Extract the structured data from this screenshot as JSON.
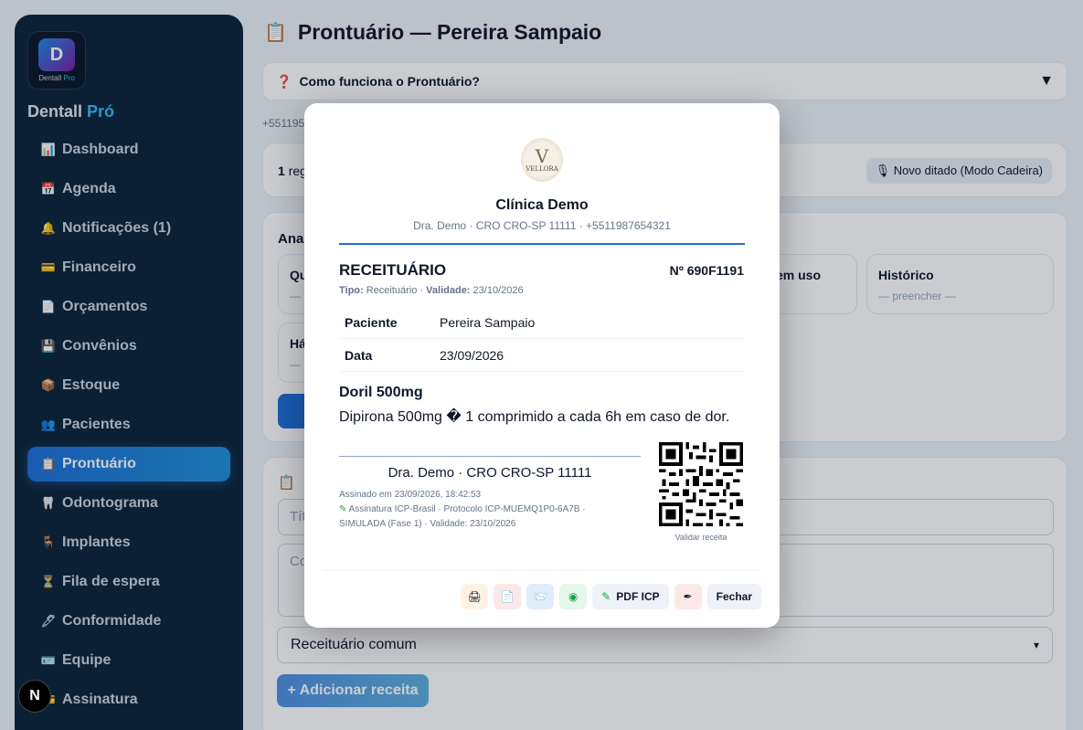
{
  "sidebar": {
    "logo_mark": "D",
    "logo_small": "Dentall",
    "logo_small_accent": "Pro",
    "brand": "Dentall",
    "brand_accent": "Pró",
    "items": [
      {
        "label": "Dashboard",
        "icon": "bar-chart-icon"
      },
      {
        "label": "Agenda",
        "icon": "calendar-icon"
      },
      {
        "label": "Notificações (1)",
        "icon": "bell-icon"
      },
      {
        "label": "Financeiro",
        "icon": "credit-card-icon"
      },
      {
        "label": "Orçamentos",
        "icon": "document-icon"
      },
      {
        "label": "Convênios",
        "icon": "id-card-icon"
      },
      {
        "label": "Estoque",
        "icon": "box-icon"
      },
      {
        "label": "Pacientes",
        "icon": "users-icon"
      },
      {
        "label": "Prontuário",
        "icon": "clipboard-icon"
      },
      {
        "label": "Odontograma",
        "icon": "tooth-icon"
      },
      {
        "label": "Implantes",
        "icon": "chair-icon"
      },
      {
        "label": "Fila de espera",
        "icon": "hourglass-icon"
      },
      {
        "label": "Conformidade",
        "icon": "pen-icon"
      },
      {
        "label": "Equipe",
        "icon": "badge-icon"
      },
      {
        "label": "Assinatura",
        "icon": "card-icon"
      }
    ],
    "active_index": 8
  },
  "main": {
    "title": "Prontuário — Pereira Sampaio",
    "help": "Como funciona o Prontuário?",
    "phone": "+551195",
    "records_count": "1",
    "records_label": "reg",
    "dictation": "🎙 Novo ditado (Modo Cadeira)",
    "anal_title": "Ana",
    "mini_cards": [
      {
        "t": "Qu",
        "v": "—"
      },
      {
        "t": "em uso",
        "v": ""
      },
      {
        "t": "Histórico",
        "v": "— preencher —"
      },
      {
        "t": "Há",
        "v": "—"
      }
    ],
    "form_title_fragment": "",
    "title_placeholder": "Títu",
    "content_placeholder": "Co",
    "select_value": "Receituário comum",
    "add_button": "+ Adicionar receita"
  },
  "modal": {
    "logo_letter": "V",
    "logo_name": "VELLORA",
    "clinic_name": "Clínica Demo",
    "clinic_sub": "Dra. Demo · CRO CRO-SP 11111 · +5511987654321",
    "doc_title": "RECEITUÁRIO",
    "doc_number": "Nº 690F1191",
    "meta_tipo_label": "Tipo:",
    "meta_tipo": "Receituário",
    "meta_validade_label": "Validade:",
    "meta_validade": "23/10/2026",
    "rows": [
      {
        "k": "Paciente",
        "v": "Pereira Sampaio"
      },
      {
        "k": "Data",
        "v": "23/09/2026"
      }
    ],
    "drug_name": "Doril 500mg",
    "drug_instruction": "Dipirona 500mg � 1 comprimido a cada 6h em caso de dor.",
    "signer": "Dra. Demo · CRO CRO-SP 11111",
    "signed_at": "Assinado em 23/09/2026, 18:42:53",
    "signature_line1": "Assinatura ICP-Brasil · Protocolo ICP-MUEMQ1P0-6A7B ·",
    "signature_line2": "SIMULADA (Fase 1) · Validade: 23/10/2026",
    "qr_label": "Validar receita",
    "actions": {
      "pdf_icp": "PDF ICP",
      "close": "Fechar"
    }
  },
  "next_badge": "N"
}
